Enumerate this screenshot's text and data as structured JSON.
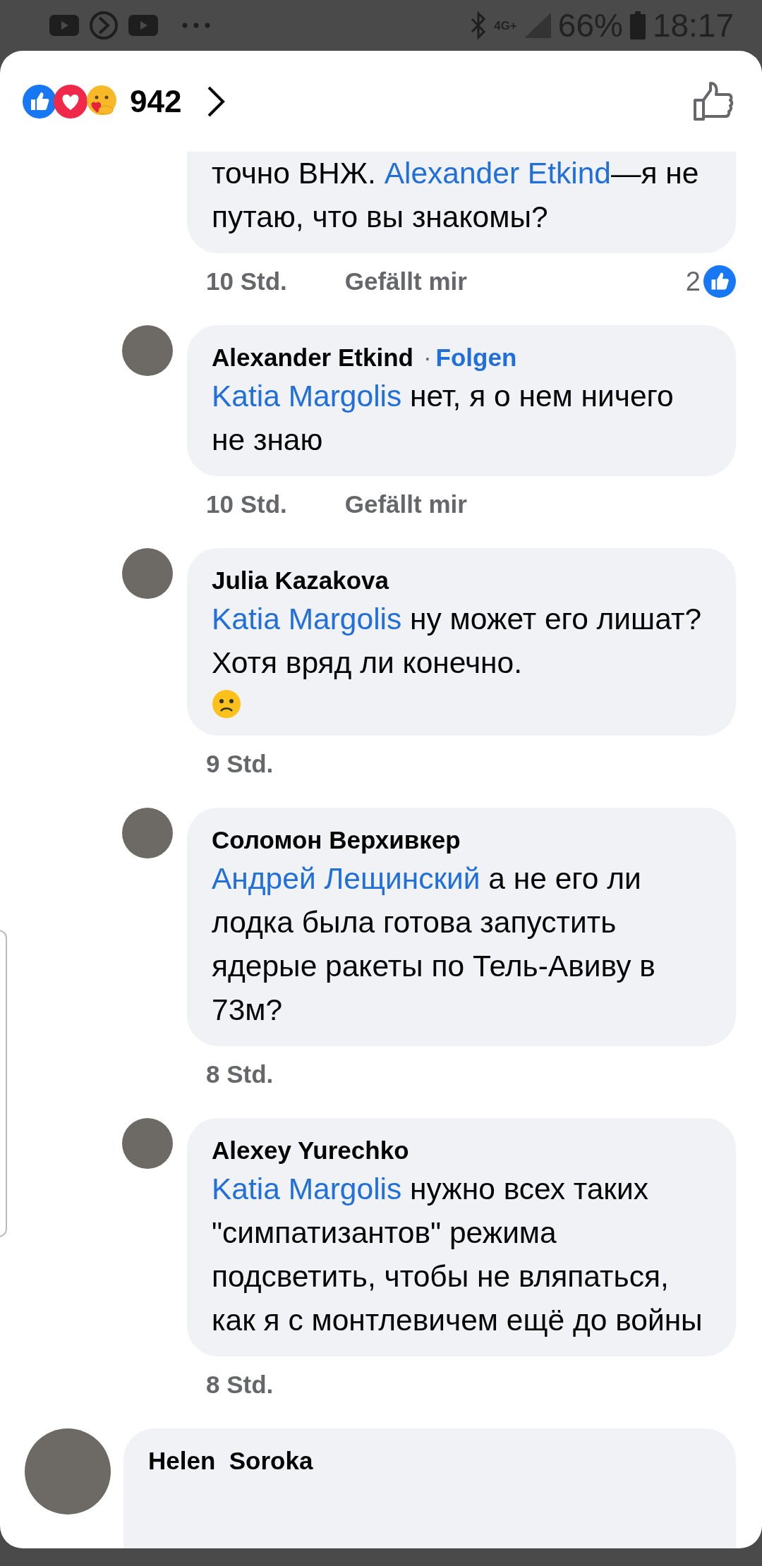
{
  "status_bar": {
    "network": "4G+",
    "battery": "66%",
    "time": "18:17"
  },
  "header": {
    "reaction_count": "942"
  },
  "comments": [
    {
      "kind": "reply",
      "parts": [
        {
          "kind": "text",
          "text": "точно ВНЖ. "
        },
        {
          "kind": "mention",
          "text": "Alexander Etkind"
        },
        {
          "kind": "text",
          "text": "—я не путаю, что вы знакомы?"
        }
      ],
      "time": "10 Std.",
      "like_label": "Gefällt mir",
      "likes": "2"
    },
    {
      "kind": "reply",
      "author": "Alexander Etkind",
      "separator": "·",
      "follow": "Folgen",
      "parts": [
        {
          "kind": "mention",
          "text": "Katia Margolis"
        },
        {
          "kind": "text",
          "text": " нет, я о нем ничего не знаю"
        }
      ],
      "time": "10 Std.",
      "like_label": "Gefällt mir"
    },
    {
      "kind": "reply",
      "author": "Julia Kazakova",
      "parts": [
        {
          "kind": "mention",
          "text": "Katia Margolis"
        },
        {
          "kind": "text",
          "text": " ну может его лишат? Хотя вряд ли конечно."
        }
      ],
      "trailing_emoji": true,
      "time": "9 Std."
    },
    {
      "kind": "reply",
      "author": "Соломон Верхивкер",
      "parts": [
        {
          "kind": "mention",
          "text": "Андрей Лещинский"
        },
        {
          "kind": "text",
          "text": " а не его ли лодка была готова запустить ядерые ракеты по Тель-Авиву в 73м?"
        }
      ],
      "time": "8 Std."
    },
    {
      "kind": "reply",
      "author": "Alexey Yurechko",
      "parts": [
        {
          "kind": "mention",
          "text": "Katia Margolis"
        },
        {
          "kind": "text",
          "text": " нужно всех таких \"симпатизантов\" режима подсветить, чтобы не вляпаться, как я с монтлевичем ещё до войны"
        }
      ],
      "time": "8 Std."
    },
    {
      "kind": "comment",
      "author": "Helen  Soroka"
    }
  ]
}
